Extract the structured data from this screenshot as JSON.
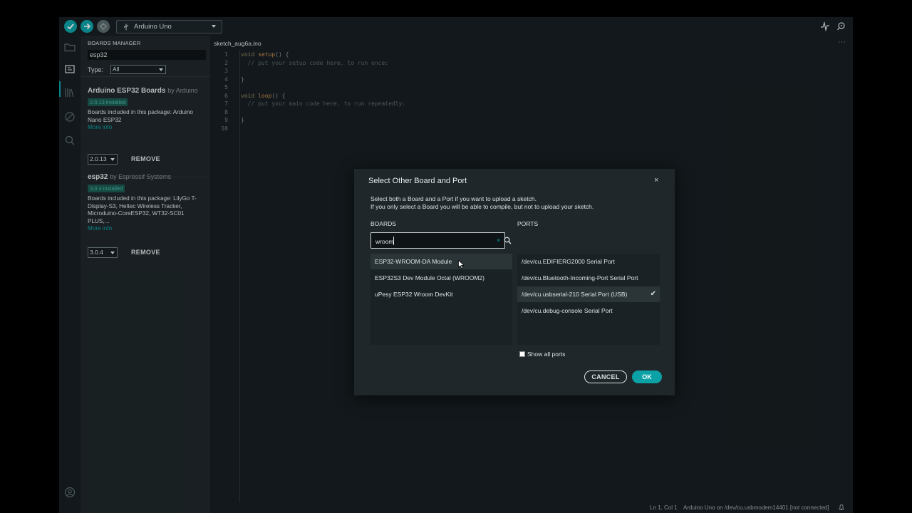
{
  "toolbar": {
    "board": "Arduino Uno"
  },
  "sidebar": {
    "title": "BOARDS MANAGER",
    "search_value": "esp32",
    "type_label": "Type:",
    "type_value": "All",
    "packages": [
      {
        "name": "Arduino ESP32 Boards",
        "by": "by Arduino",
        "installed": "2.0.13 installed",
        "desc_line1": "Boards included in this package: Arduino",
        "desc_line2": "Nano ESP32",
        "more": "More info",
        "version": "2.0.13",
        "remove": "REMOVE"
      },
      {
        "name": "esp32",
        "by": "by Espressif Systems",
        "installed": "3.0.4 installed",
        "desc_line1": "Boards included in this package: LilyGo T-",
        "desc_line2": "Display-S3, Heltec Wireless Tracker,",
        "desc_line3": "Microduino-CoreESP32, WT32-SC01 PLUS,...",
        "more": "More info",
        "version": "3.0.4",
        "remove": "REMOVE"
      }
    ]
  },
  "editor": {
    "tab": "sketch_aug6a.ino",
    "more": "···",
    "lines": [
      "1",
      "2",
      "3",
      "4",
      "5",
      "6",
      "7",
      "8",
      "9",
      "10"
    ],
    "code": {
      "l1_kw": "void",
      "l1_fn": "setup",
      "l1_rest": "() {",
      "l2": "  // put your setup code here, to run once:",
      "l4": "}",
      "l6_kw": "void",
      "l6_fn": "loop",
      "l6_rest": "() {",
      "l7": "  // put your main code here, to run repeatedly:",
      "l9": "}"
    }
  },
  "status": {
    "position": "Ln 1, Col 1",
    "board": "Arduino Uno on /dev/cu.usbmodem14401 [not connected]"
  },
  "dialog": {
    "title": "Select Other Board and Port",
    "close": "×",
    "desc1": "Select both a Board and a Port if you want to upload a sketch.",
    "desc2": "If you only select a Board you will be able to compile, but not to upload your sketch.",
    "boards_heading": "BOARDS",
    "ports_heading": "PORTS",
    "search_value": "wroom",
    "clear": "×",
    "boards": [
      "ESP32-WROOM-DA Module",
      "ESP32S3 Dev Module Octal (WROOM2)",
      "uPesy ESP32 Wroom DevKit"
    ],
    "ports": [
      "/dev/cu.EDIFIERG2000 Serial Port",
      "/dev/cu.Bluetooth-Incoming-Port Serial Port",
      "/dev/cu.usbserial-210 Serial Port (USB)",
      "/dev/cu.debug-console Serial Port"
    ],
    "selected_port_check": "✔",
    "show_all": "Show all ports",
    "cancel": "CANCEL",
    "ok": "OK"
  },
  "colors": {
    "accent": "#0ca1a6",
    "background": "#171e21",
    "sidebar": "#1f272a"
  }
}
